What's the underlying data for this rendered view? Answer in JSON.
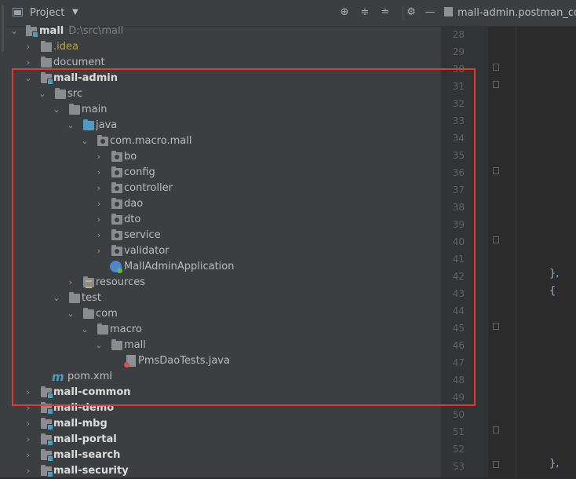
{
  "panel": {
    "title": "Project"
  },
  "editor": {
    "tab_title": "mall-admin.postman_colle",
    "line_numbers": [
      "28",
      "29",
      "30",
      "31",
      "32",
      "33",
      "34",
      "35",
      "36",
      "37",
      "38",
      "39",
      "40",
      "41",
      "42",
      "43",
      "44",
      "45",
      "46",
      "47",
      "48",
      "49",
      "50",
      "51",
      "52",
      "53"
    ],
    "braces": [
      "},",
      "{",
      "},"
    ]
  },
  "tree": {
    "root": {
      "label": "mall",
      "path": "D:\\src\\mall"
    },
    "idea": ".idea",
    "document": "document",
    "mall_admin": "mall-admin",
    "src": "src",
    "main": "main",
    "java": "java",
    "pkg": "com.macro.mall",
    "bo": "bo",
    "config": "config",
    "controller": "controller",
    "dao": "dao",
    "dto": "dto",
    "service": "service",
    "validator": "validator",
    "app": "MallAdminApplication",
    "resources": "resources",
    "test": "test",
    "com": "com",
    "macro": "macro",
    "mall": "mall",
    "test_file": "PmsDaoTests.java",
    "pom": "pom.xml",
    "modules": [
      "mall-common",
      "mall-demo",
      "mall-mbg",
      "mall-portal",
      "mall-search",
      "mall-security"
    ]
  },
  "colors": {
    "highlight": "#e53935",
    "module_blue": "#4d9bc1",
    "background": "#3c3f41"
  }
}
